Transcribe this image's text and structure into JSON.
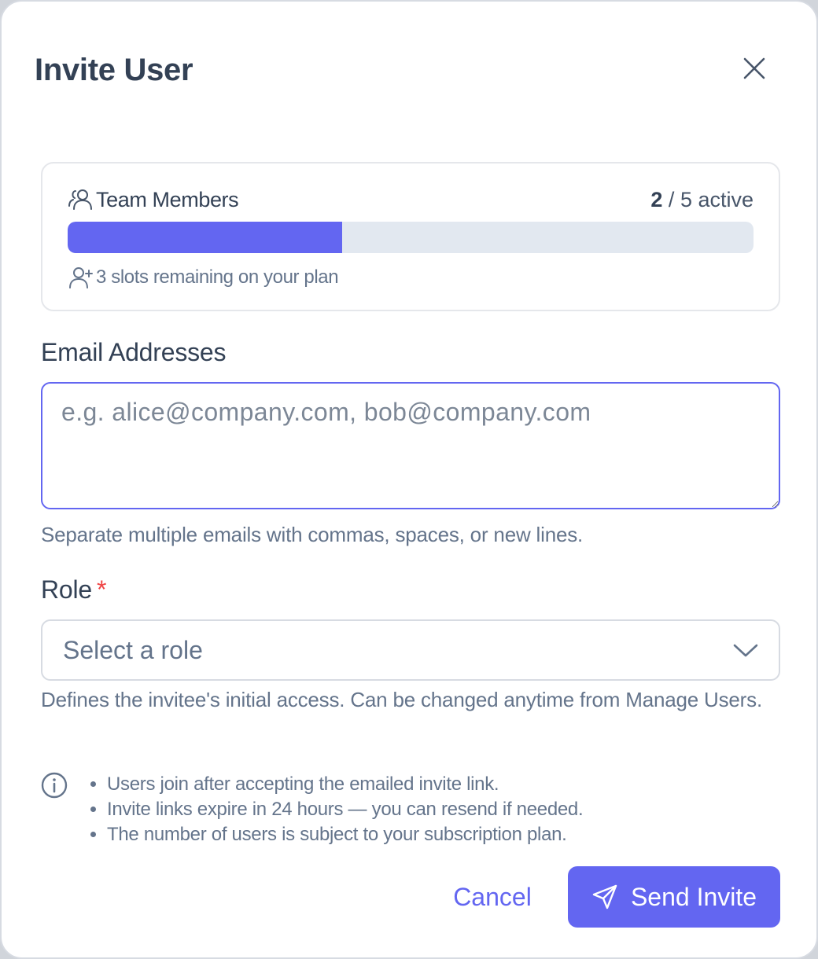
{
  "dialog": {
    "title": "Invite User"
  },
  "usage": {
    "title": "Team Members",
    "used": "2",
    "separator": " / ",
    "total_suffix": "5 active",
    "progress_fraction": 0.4,
    "remaining_text": "3 slots remaining on your plan"
  },
  "email": {
    "label": "Email Addresses",
    "placeholder": "e.g. alice@company.com, bob@company.com",
    "value": "",
    "help": "Separate multiple emails with commas, spaces, or new lines."
  },
  "role": {
    "label": "Role",
    "required_marker": "*",
    "selected": "Select a role",
    "help": "Defines the invitee's initial access. Can be changed anytime from Manage Users."
  },
  "info": {
    "items": [
      "Users join after accepting the emailed invite link.",
      "Invite links expire in 24 hours — you can resend if needed.",
      "The number of users is subject to your subscription plan."
    ]
  },
  "actions": {
    "cancel_label": "Cancel",
    "send_label": "Send Invite"
  },
  "colors": {
    "accent": "#6366f1",
    "required": "#ef4444",
    "track": "#e2e8f0"
  },
  "icons": {
    "close": "close-icon",
    "team": "users-icon",
    "user_plus": "user-plus-icon",
    "chevron": "chevron-down-icon",
    "info": "info-icon",
    "send": "send-icon"
  }
}
